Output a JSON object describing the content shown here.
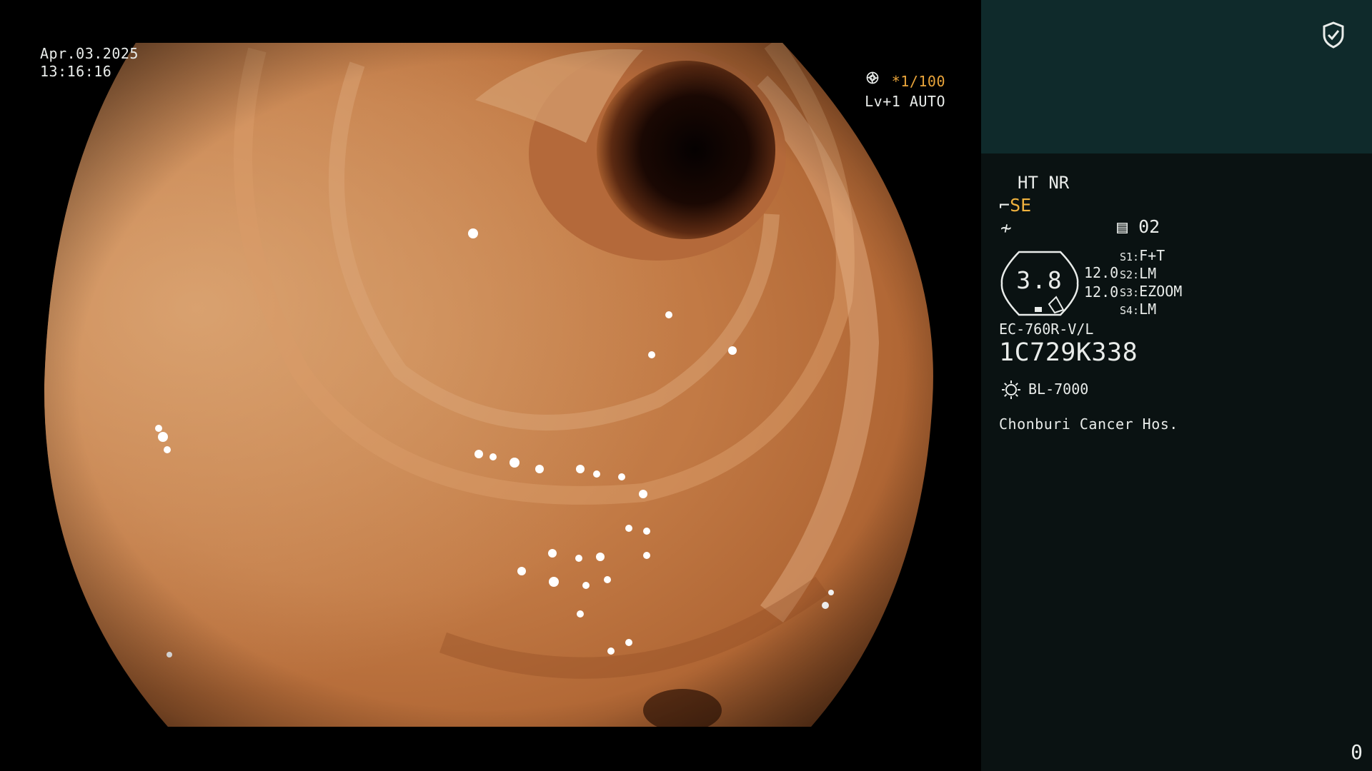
{
  "video": {
    "date": "Apr.03.2025",
    "time": "13:16:16",
    "shutter": "*1/100",
    "iris": "Lv+1 AUTO",
    "iris_icon": "iris-icon",
    "shutter_icon": "shutter-icon"
  },
  "panel": {
    "accent_color": "#0f2a2b",
    "enhancement": "HT NR",
    "structure_mode": "SE",
    "structure_icon": "structure-icon",
    "contrast_icon": "contrast-icon",
    "color_enhancement_icon": "color-enhancement-icon",
    "color_enhancement": "02",
    "zoom_value": "3.8",
    "gauge_values": [
      "12.0",
      "12.0"
    ],
    "switches": [
      {
        "key": "S1:",
        "value": "F+T"
      },
      {
        "key": "S2:",
        "value": "LM"
      },
      {
        "key": "S3:",
        "value": "EZOOM"
      },
      {
        "key": "S4:",
        "value": "LM"
      }
    ],
    "scope_model": "EC-760R-V/L",
    "scope_serial": "1C729K338",
    "light_source": "BL-7000",
    "light_icon": "light-source-icon",
    "hospital": "Chonburi Cancer Hos.",
    "image_counter": "0",
    "shield_icon": "shield-check-icon"
  }
}
